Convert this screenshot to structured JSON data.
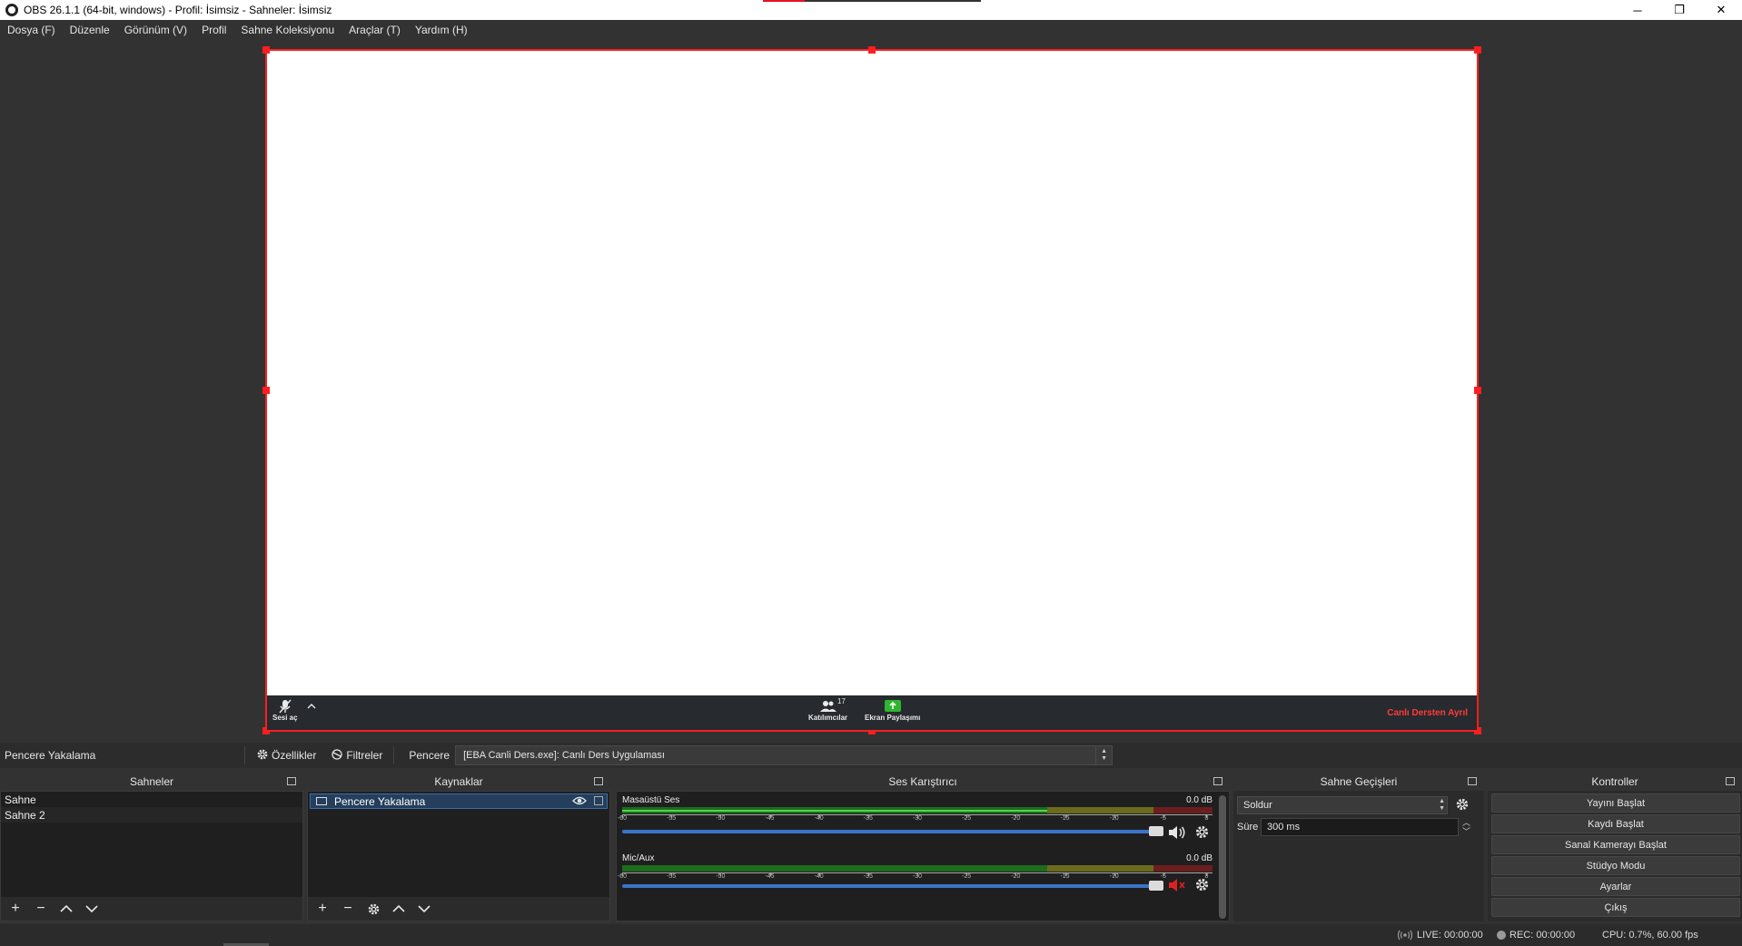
{
  "window": {
    "title": "OBS 26.1.1 (64-bit, windows) - Profil: İsimsiz - Sahneler: İsimsiz",
    "minimize": "─",
    "restore": "❐",
    "close": "✕"
  },
  "menu": {
    "items": [
      "Dosya (F)",
      "Düzenle",
      "Görünüm (V)",
      "Profil",
      "Sahne Koleksiyonu",
      "Araçlar (T)",
      "Yardım (H)"
    ]
  },
  "capture": {
    "mic_label": "Sesi aç",
    "participants_label": "Katılımcılar",
    "participants_count": "17",
    "share_label": "Ekran Paylaşımı",
    "leave_label": "Canlı Dersten Ayrıl"
  },
  "source_toolbar": {
    "selected_source": "Pencere Yakalama",
    "properties": "Özellikler",
    "filters": "Filtreler",
    "window_label": "Pencere",
    "window_value": "[EBA Canli Ders.exe]: Canlı Ders Uygulaması"
  },
  "scenes": {
    "title": "Sahneler",
    "items": [
      "Sahne",
      "Sahne 2"
    ]
  },
  "sources": {
    "title": "Kaynaklar",
    "items": [
      "Pencere Yakalama"
    ]
  },
  "mixer": {
    "title": "Ses Karıştırıcı",
    "channels": [
      {
        "name": "Masaüstü Ses",
        "db": "0.0 dB",
        "volume": 1.0,
        "muted": false
      },
      {
        "name": "Mic/Aux",
        "db": "0.0 dB",
        "volume": 1.0,
        "muted": true
      }
    ],
    "scale": [
      "-60",
      "-55",
      "-50",
      "-45",
      "-40",
      "-35",
      "-30",
      "-25",
      "-20",
      "-15",
      "-10",
      "-5",
      "0"
    ]
  },
  "transitions": {
    "title": "Sahne Geçişleri",
    "selected": "Soldur",
    "duration_label": "Süre",
    "duration_value": "300 ms"
  },
  "controls": {
    "title": "Kontroller",
    "buttons": [
      "Yayını Başlat",
      "Kaydı Başlat",
      "Sanal Kamerayı Başlat",
      "Stüdyo Modu",
      "Ayarlar",
      "Çıkış"
    ]
  },
  "status": {
    "live": "LIVE: 00:00:00",
    "rec": "REC: 00:00:00",
    "cpu": "CPU: 0.7%, 60.00 fps"
  },
  "colors": {
    "selection_red": "#ff1e1e",
    "accent_blue": "#3a74c8",
    "leave_red": "#ff3b3b",
    "share_green": "#2fb52f"
  }
}
